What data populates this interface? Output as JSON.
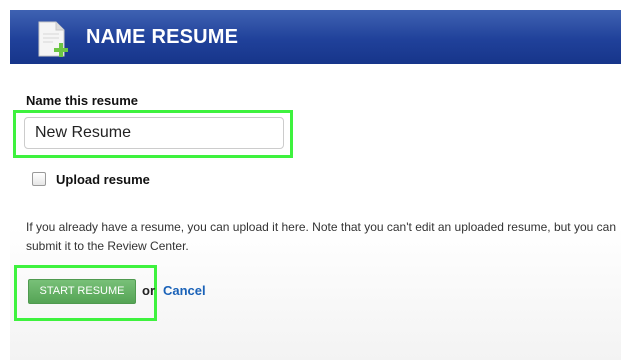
{
  "header": {
    "title": "NAME RESUME",
    "icon": "new-document-icon"
  },
  "form": {
    "name_label": "Name this resume",
    "name_value": "New Resume",
    "upload_checked": false,
    "upload_label": "Upload resume",
    "help_text": "If you already have a resume, you can upload it here. Note that you can't edit an uploaded resume, but you can submit it to the Review Center."
  },
  "actions": {
    "start_label": "START RESUME",
    "or_text": "or",
    "cancel_label": "Cancel"
  },
  "colors": {
    "header_blue": "#20419a",
    "highlight_green": "#3ef23e",
    "button_green": "#5aaa5a",
    "link_blue": "#1a62b8"
  }
}
